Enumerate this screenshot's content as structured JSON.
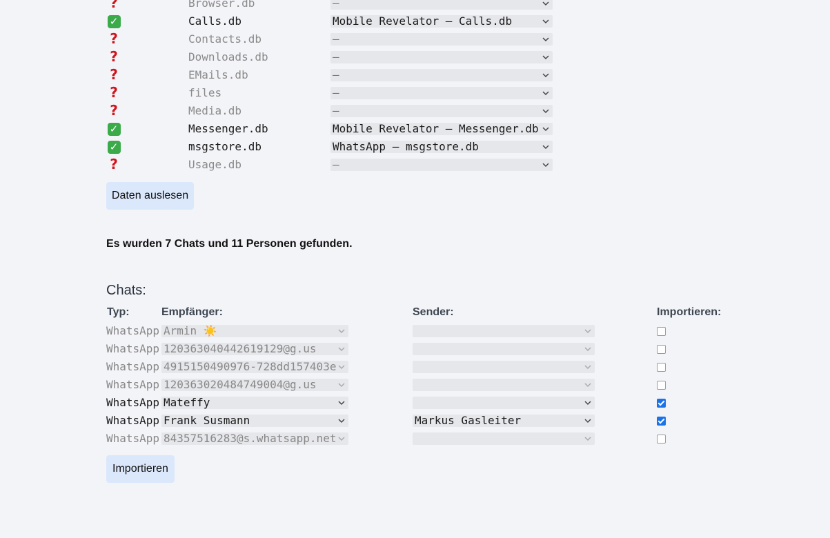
{
  "files": [
    {
      "status": "unknown",
      "name": "Browser.db",
      "selected": "–"
    },
    {
      "status": "ok",
      "name": "Calls.db",
      "selected": "Mobile Revelator – Calls.db"
    },
    {
      "status": "unknown",
      "name": "Contacts.db",
      "selected": "–"
    },
    {
      "status": "unknown",
      "name": "Downloads.db",
      "selected": "–"
    },
    {
      "status": "unknown",
      "name": "EMails.db",
      "selected": "–"
    },
    {
      "status": "unknown",
      "name": "files",
      "selected": "–"
    },
    {
      "status": "unknown",
      "name": "Media.db",
      "selected": "–"
    },
    {
      "status": "ok",
      "name": "Messenger.db",
      "selected": "Mobile Revelator – Messenger.db"
    },
    {
      "status": "ok",
      "name": "msgstore.db",
      "selected": "WhatsApp – msgstore.db"
    },
    {
      "status": "unknown",
      "name": "Usage.db",
      "selected": "–"
    }
  ],
  "status_icons": {
    "ok": "check-mark-icon",
    "unknown": "question-mark-icon"
  },
  "read_button_label": "Daten auslesen",
  "result_text": "Es wurden 7 Chats und 11 Personen gefunden.",
  "chats": {
    "title": "Chats:",
    "headers": {
      "type": "Typ:",
      "recipient": "Empfänger:",
      "sender": "Sender:",
      "import": "Importieren:"
    },
    "rows": [
      {
        "type": "WhatsApp",
        "recipient": "Armin ☀️",
        "sender": "",
        "import": false
      },
      {
        "type": "WhatsApp",
        "recipient": "120363040442619129@g.us",
        "sender": "",
        "import": false
      },
      {
        "type": "WhatsApp",
        "recipient": "4915150490976-728dd157403e",
        "sender": "",
        "import": false
      },
      {
        "type": "WhatsApp",
        "recipient": "120363020484749004@g.us",
        "sender": "",
        "import": false
      },
      {
        "type": "WhatsApp",
        "recipient": "Mateffy",
        "sender": "",
        "import": true
      },
      {
        "type": "WhatsApp",
        "recipient": "Frank Susmann",
        "sender": "Markus Gasleiter",
        "import": true
      },
      {
        "type": "WhatsApp",
        "recipient": "84357516283@s.whatsapp.net",
        "sender": "",
        "import": false
      }
    ]
  },
  "import_button_label": "Importieren",
  "colors": {
    "background": "#f3f4f8",
    "button": "#dbe8fb",
    "checkbox_on": "#1a73e8",
    "ok": "#3bab4a",
    "unknown": "#d0151d"
  }
}
